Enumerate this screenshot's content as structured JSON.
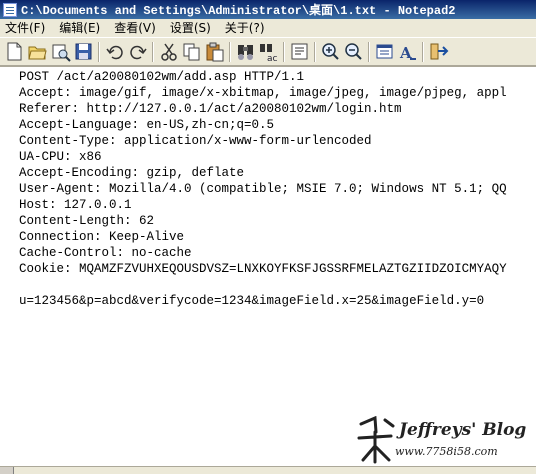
{
  "window": {
    "title": "C:\\Documents and Settings\\Administrator\\桌面\\1.txt - Notepad2"
  },
  "menu": [
    {
      "id": "file",
      "label": "文件(F)"
    },
    {
      "id": "edit",
      "label": "编辑(E)"
    },
    {
      "id": "view",
      "label": "查看(V)"
    },
    {
      "id": "settings",
      "label": "设置(S)"
    },
    {
      "id": "about",
      "label": "关于(?)"
    }
  ],
  "toolbar": [
    {
      "icon": "new-file-icon"
    },
    {
      "icon": "open-folder-icon"
    },
    {
      "icon": "browse-icon"
    },
    {
      "icon": "save-icon"
    },
    {
      "sep": true
    },
    {
      "icon": "undo-icon"
    },
    {
      "icon": "redo-icon"
    },
    {
      "sep": true
    },
    {
      "icon": "cut-icon"
    },
    {
      "icon": "copy-icon"
    },
    {
      "icon": "paste-icon"
    },
    {
      "sep": true
    },
    {
      "icon": "find-icon"
    },
    {
      "icon": "replace-icon"
    },
    {
      "sep": true
    },
    {
      "icon": "word-wrap-icon"
    },
    {
      "sep": true
    },
    {
      "icon": "zoom-in-icon"
    },
    {
      "icon": "zoom-out-icon"
    },
    {
      "sep": true
    },
    {
      "icon": "scheme-icon"
    },
    {
      "icon": "font-icon"
    },
    {
      "sep": true
    },
    {
      "icon": "exit-icon"
    }
  ],
  "editor": {
    "lines": [
      "POST /act/a20080102wm/add.asp HTTP/1.1",
      "Accept: image/gif, image/x-xbitmap, image/jpeg, image/pjpeg, appl",
      "Referer: http://127.0.0.1/act/a20080102wm/login.htm",
      "Accept-Language: en-US,zh-cn;q=0.5",
      "Content-Type: application/x-www-form-urlencoded",
      "UA-CPU: x86",
      "Accept-Encoding: gzip, deflate",
      "User-Agent: Mozilla/4.0 (compatible; MSIE 7.0; Windows NT 5.1; QQ",
      "Host: 127.0.0.1",
      "Content-Length: 62",
      "Connection: Keep-Alive",
      "Cache-Control: no-cache",
      "Cookie: MQAMZFZVUHXEQOUSDVSZ=LNXKOYFKSFJGSSRFMELAZTGZIIDZOICMYAQY",
      "",
      "u=123456&p=abcd&verifycode=1234&imageField.x=25&imageField.y=0"
    ]
  },
  "watermark": {
    "title": "Jeffreys' Blog",
    "url": "www.7758i58.com"
  }
}
